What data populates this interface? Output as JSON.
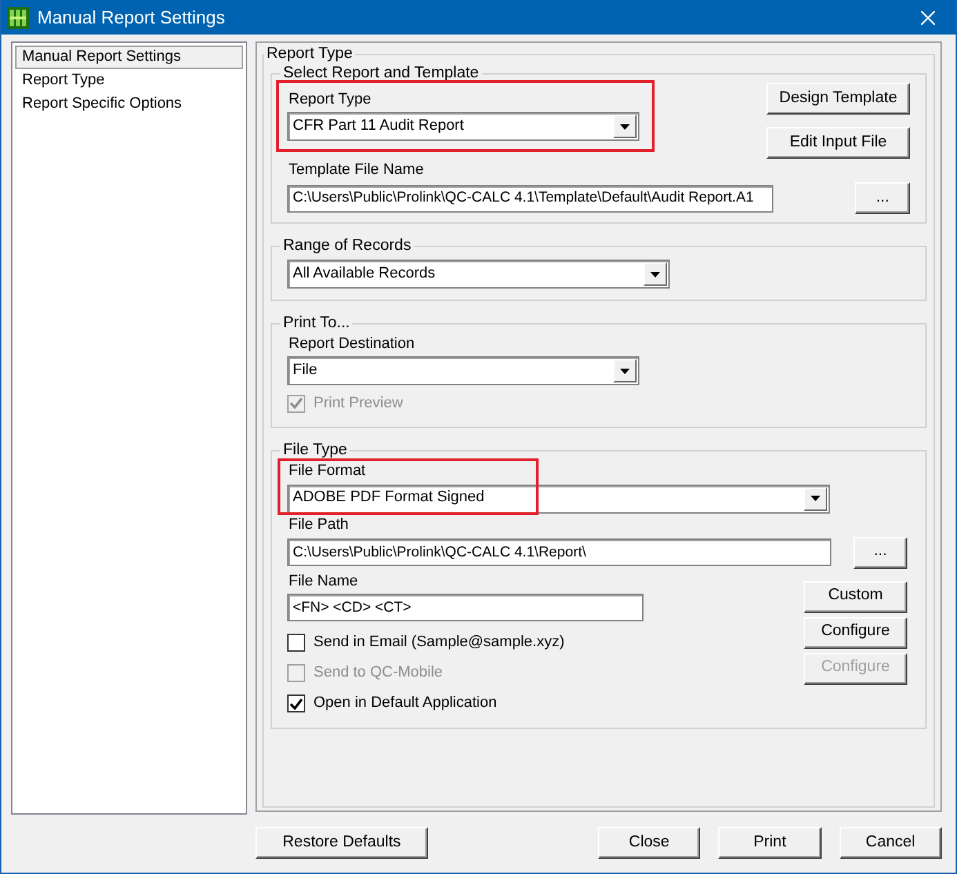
{
  "window": {
    "title": "Manual Report Settings"
  },
  "sidebar": {
    "items": [
      {
        "label": "Manual Report Settings",
        "selected": true
      },
      {
        "label": "Report Type",
        "selected": false
      },
      {
        "label": "Report Specific Options",
        "selected": false
      }
    ]
  },
  "report_type": {
    "title": "Report Type",
    "template_group": {
      "title": "Select Report and Template",
      "report_type_label": "Report Type",
      "report_type_value": "CFR Part 11 Audit Report",
      "highlighted": true,
      "template_label": "Template File Name",
      "template_value": "C:\\Users\\Public\\Prolink\\QC-CALC 4.1\\Template\\Default\\Audit Report.A1",
      "design_button": "Design Template",
      "edit_button": "Edit Input File",
      "browse_button": "..."
    },
    "range_group": {
      "title": "Range of Records",
      "value": "All Available Records"
    },
    "print_group": {
      "title": "Print To...",
      "destination_label": "Report Destination",
      "destination_value": "File",
      "preview": {
        "label": "Print Preview",
        "checked": true,
        "disabled": true
      }
    },
    "file_group": {
      "title": "File Type",
      "format_label": "File Format",
      "format_value": "ADOBE PDF Format Signed",
      "highlighted": true,
      "path_label": "File Path",
      "path_value": "C:\\Users\\Public\\Prolink\\QC-CALC 4.1\\Report\\",
      "browse_button": "...",
      "name_label": "File Name",
      "name_value": "<FN> <CD> <CT>",
      "options": [
        {
          "label": "Send in Email (Sample@sample.xyz)",
          "checked": false,
          "disabled": false
        },
        {
          "label": "Send to QC-Mobile",
          "checked": false,
          "disabled": true
        },
        {
          "label": "Open in Default Application",
          "checked": true,
          "disabled": false
        }
      ],
      "side_buttons": [
        {
          "label": "Custom",
          "disabled": false
        },
        {
          "label": "Configure",
          "disabled": false
        },
        {
          "label": "Configure",
          "disabled": true
        }
      ]
    }
  },
  "footer_buttons": [
    {
      "label": "Restore Defaults"
    },
    {
      "label": "Close"
    },
    {
      "label": "Print"
    },
    {
      "label": "Cancel"
    }
  ]
}
